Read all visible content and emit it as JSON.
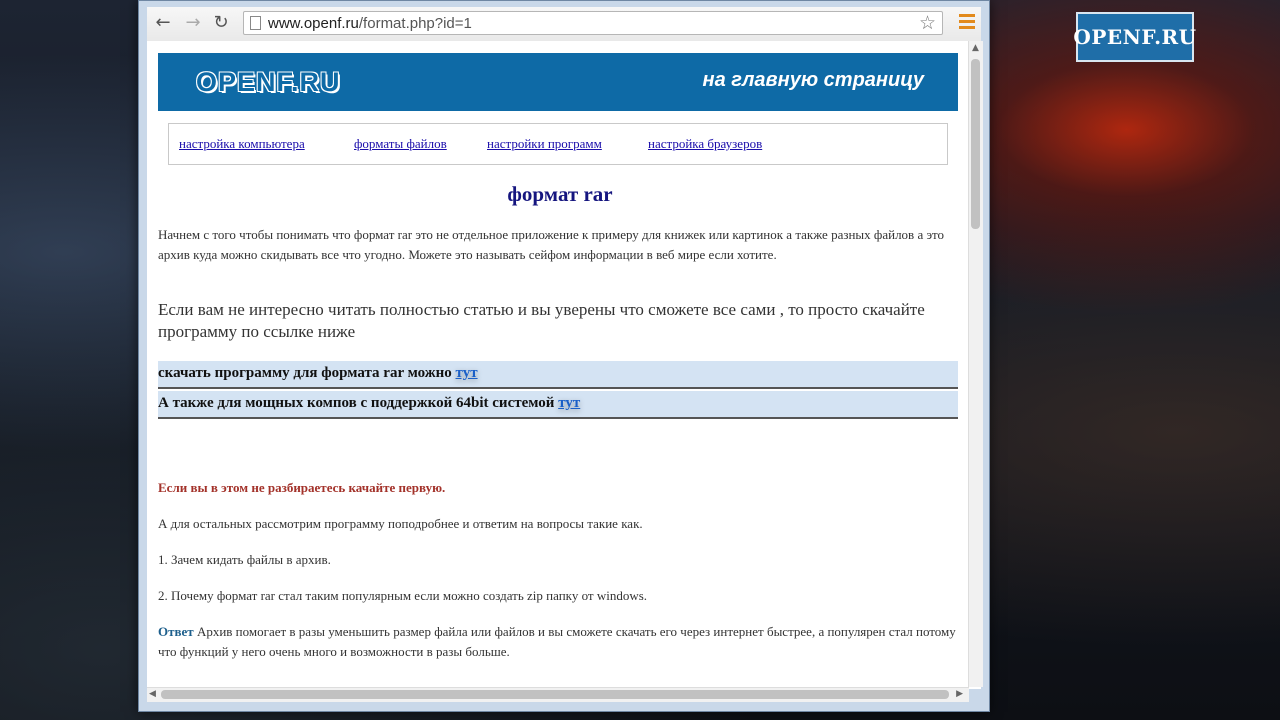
{
  "browser": {
    "url_host": "www.openf.ru",
    "url_path": "/format.php?id=1"
  },
  "overlay_logo": "OPENF.RU",
  "site": {
    "logo": "OPENF.RU",
    "home_link": "на главную страницу",
    "menu": [
      "настройка компьютера",
      "форматы файлов",
      "настройки программ",
      "настройка браузеров"
    ]
  },
  "content": {
    "title": "формат rar",
    "intro": "Начнем с того чтобы понимать что формат rar это не отдельное приложение к примеру для книжек или картинок а также разных файлов а это архив куда можно скидывать все что угодно. Можете это называть сейфом информации в веб мире если хотите.",
    "lead": "Если вам не интересно читать полностью статью и вы уверены что сможете все сами , то просто скачайте программу по ссылке ниже",
    "download_rows": [
      {
        "text": "скачать программу для формата rar можно ",
        "link": "тут"
      },
      {
        "text": "А также для мощных компов с поддержкой 64bit системой ",
        "link": "тут"
      }
    ],
    "red_note": "Если вы в этом не разбираетесь качайте первую.",
    "text1": "А для остальных рассмотрим программу поподробнее и ответим на вопросы такие как.",
    "q1": "1. Зачем кидать файлы в архив.",
    "q2": "2. Почему формат rar стал таким популярным если можно создать zip папку от windows.",
    "answer_label": "Ответ",
    "answer_text": " Архив помогает в разы уменьшить размер файла или файлов и вы сможете скачать его через интернет быстрее, а популярен стал потому что функций у него очень много и возможности в разы больше."
  }
}
